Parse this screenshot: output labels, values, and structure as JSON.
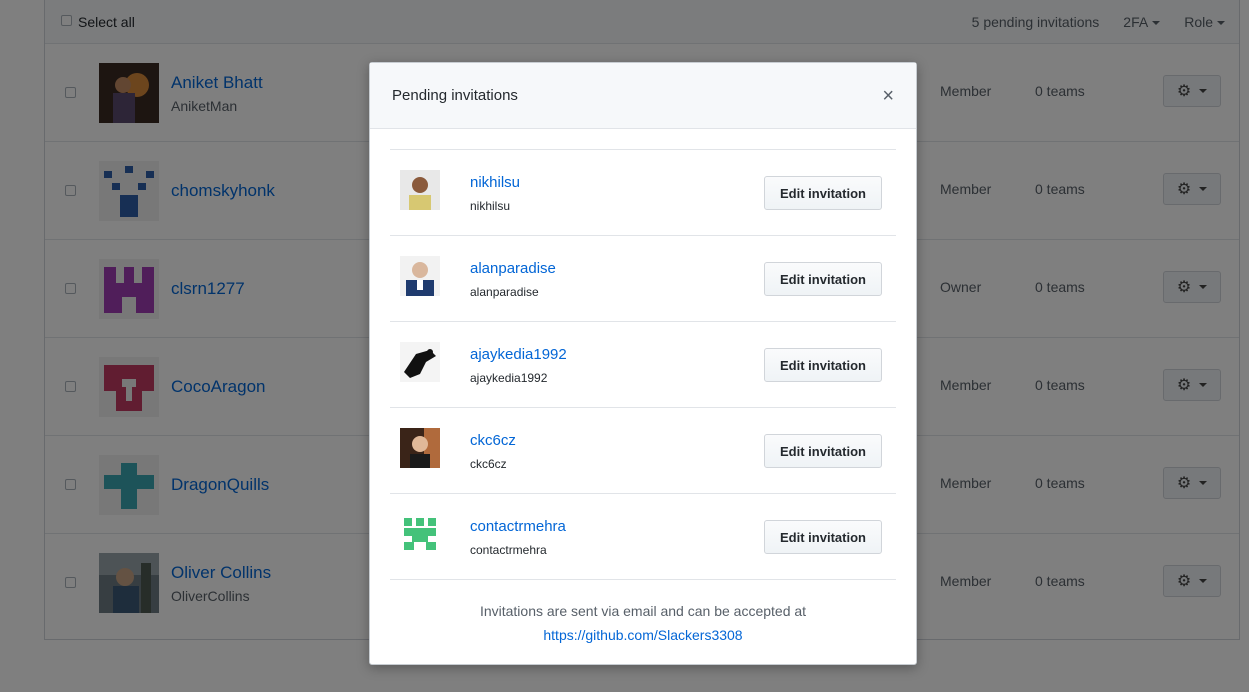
{
  "header": {
    "select_all": "Select all",
    "pending_count": "5 pending invitations",
    "twofa": "2FA",
    "role": "Role"
  },
  "members": [
    {
      "name": "Aniket Bhatt",
      "login": "AniketMan",
      "role": "Member",
      "teams": "0 teams"
    },
    {
      "name": "chomskyhonk",
      "login": "",
      "role": "Member",
      "teams": "0 teams"
    },
    {
      "name": "clsrn1277",
      "login": "",
      "role": "Owner",
      "teams": "0 teams"
    },
    {
      "name": "CocoAragon",
      "login": "",
      "role": "Member",
      "teams": "0 teams"
    },
    {
      "name": "DragonQuills",
      "login": "",
      "role": "Member",
      "teams": "0 teams"
    },
    {
      "name": "Oliver Collins",
      "login": "OliverCollins",
      "role": "Member",
      "teams": "0 teams"
    }
  ],
  "modal": {
    "title": "Pending invitations",
    "close": "×",
    "edit_label": "Edit invitation",
    "invitations": [
      {
        "name": "nikhilsu",
        "login": "nikhilsu"
      },
      {
        "name": "alanparadise",
        "login": "alanparadise"
      },
      {
        "name": "ajaykedia1992",
        "login": "ajaykedia1992"
      },
      {
        "name": "ckc6cz",
        "login": "ckc6cz"
      },
      {
        "name": "contactrmehra",
        "login": "contactrmehra"
      }
    ],
    "footer_text": "Invitations are sent via email and can be accepted at",
    "footer_link": "https://github.com/Slackers3308"
  },
  "colors": {
    "link": "#0366d6",
    "identicon_chomsky": "#2e5fa8",
    "identicon_clsrn": "#a03cb4",
    "identicon_coco": "#c23b62",
    "identicon_dragon": "#3ba7b2",
    "identicon_contact": "#44c27a"
  }
}
